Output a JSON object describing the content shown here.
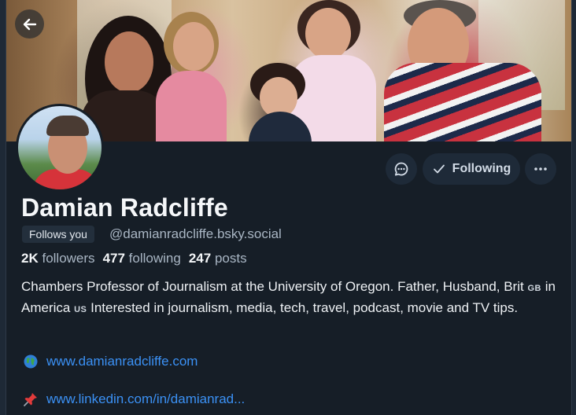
{
  "profile": {
    "display_name": "Damian Radcliffe",
    "follows_you": "Follows you",
    "handle": "@damianradcliffe.bsky.social",
    "stats": {
      "followers_count": "2K",
      "followers_label": "followers",
      "following_count": "477",
      "following_label": "following",
      "posts_count": "247",
      "posts_label": "posts"
    },
    "bio": {
      "part1": "Chambers Professor of Journalism at the University of Oregon. Father, Husband, Brit",
      "flag_gb": "GB",
      "part2": "in America",
      "flag_us": "US",
      "part3": "Interested in journalism, media, tech, travel, podcast, movie and TV tips."
    },
    "links": [
      {
        "emoji": "globe-icon",
        "text": "www.damianradcliffe.com"
      },
      {
        "emoji": "pushpin-icon",
        "text": "www.linkedin.com/in/damianrad..."
      }
    ]
  },
  "actions": {
    "message_icon": "message-icon",
    "following_label": "Following",
    "more_icon": "ellipsis-icon",
    "back_icon": "back-arrow-icon"
  },
  "colors": {
    "background": "#161e27",
    "link": "#3b91f5",
    "button_bg": "#1e2a38"
  }
}
